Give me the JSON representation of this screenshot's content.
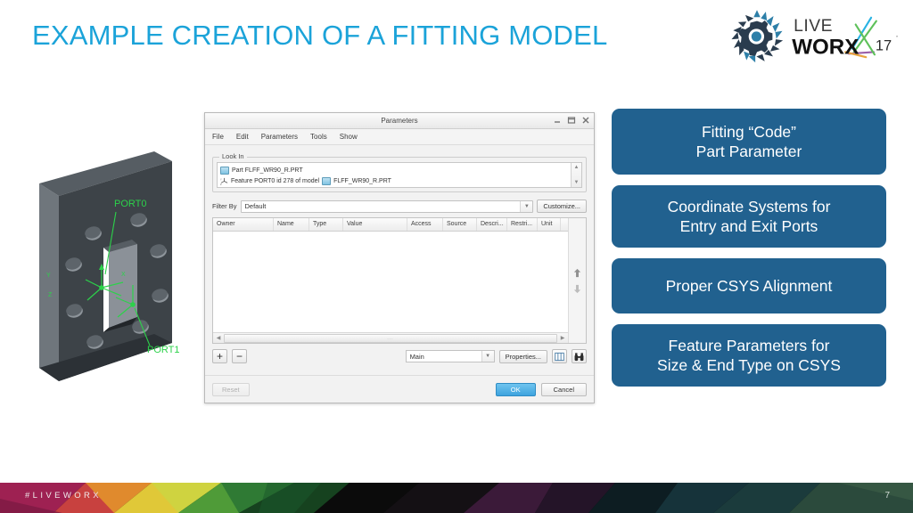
{
  "slide": {
    "title": "EXAMPLE CREATION OF A FITTING MODEL",
    "title_color": "#1ba3d9",
    "accent_color": "#21618f"
  },
  "logo": {
    "name": "liveworx-17-logo",
    "line1": "LIVE",
    "line2": "WORX",
    "year": "17",
    "gear_icon": "gear-icon"
  },
  "part_graphic": {
    "name": "waveguide-flange-3d-model",
    "port0_label": "PORT0",
    "port1_label": "PORT1",
    "axis_x": "X",
    "axis_y": "Y",
    "axis_z": "Z",
    "csys_color": "#2cd24a",
    "body_color": "#3e4449"
  },
  "dialog": {
    "title": "Parameters",
    "window_buttons": [
      "minimize-icon",
      "maximize-icon",
      "close-icon"
    ],
    "menu": [
      "File",
      "Edit",
      "Parameters",
      "Tools",
      "Show"
    ],
    "lookin": {
      "legend": "Look In",
      "rows": [
        {
          "icon": "part-icon",
          "text": "Part FLFF_WR90_R.PRT"
        },
        {
          "icon": "csys-icon",
          "text": "Feature PORT0 id 278 of model",
          "text2": "FLFF_WR90_R.PRT",
          "icon2": "part-icon"
        }
      ]
    },
    "filter": {
      "label": "Filter By",
      "value": "Default",
      "customize_label": "Customize..."
    },
    "table": {
      "columns": [
        "Owner",
        "Name",
        "Type",
        "Value",
        "Access",
        "Source",
        "Descri...",
        "Restri...",
        "Unit"
      ],
      "rows": []
    },
    "toolbar": {
      "add_label": "+",
      "remove_label": "−",
      "scope_value": "Main",
      "properties_label": "Properties...",
      "columns_icon": "table-columns-icon",
      "find_icon": "binoculars-icon"
    },
    "footer": {
      "reset_label": "Reset",
      "ok_label": "OK",
      "cancel_label": "Cancel"
    }
  },
  "callouts": [
    {
      "name": "callout-fitting-code-part-parameter",
      "line1": "Fitting “Code”",
      "line2": "Part Parameter"
    },
    {
      "name": "callout-coordinate-systems",
      "line1": "Coordinate Systems for",
      "line2": "Entry and Exit Ports"
    },
    {
      "name": "callout-proper-csys-alignment",
      "line1": "Proper CSYS Alignment",
      "line2": ""
    },
    {
      "name": "callout-feature-parameters",
      "line1": "Feature Parameters for",
      "line2": "Size & End Type on CSYS"
    }
  ],
  "page_footer": {
    "hashtag": "#LIVEWORX",
    "page_number": "7"
  }
}
